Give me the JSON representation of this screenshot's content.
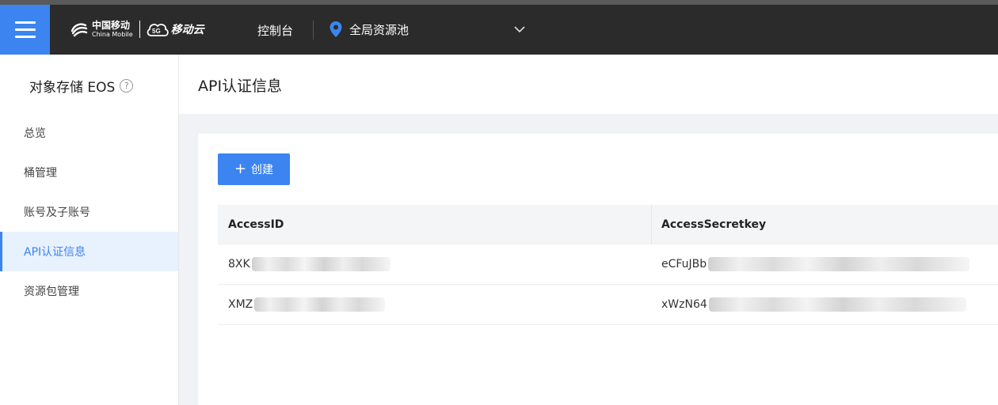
{
  "header": {
    "brand_cn": "中国移动",
    "brand_en": "China Mobile",
    "cloud_name": "移动云",
    "console": "控制台",
    "region": "全局资源池"
  },
  "sidebar": {
    "title": "对象存储 EOS",
    "items": [
      {
        "label": "总览"
      },
      {
        "label": "桶管理"
      },
      {
        "label": "账号及子账号"
      },
      {
        "label": "API认证信息",
        "active": true
      },
      {
        "label": "资源包管理"
      }
    ]
  },
  "page": {
    "title": "API认证信息",
    "create_label": "创建"
  },
  "table": {
    "columns": [
      "AccessID",
      "AccessSecretkey"
    ],
    "rows": [
      {
        "access_id": "8XK",
        "secret": "eCFuJBb"
      },
      {
        "access_id": "XMZ",
        "secret": "xWzN64"
      }
    ]
  },
  "colors": {
    "accent": "#3c85f0",
    "topbar": "#2b2b2b"
  }
}
